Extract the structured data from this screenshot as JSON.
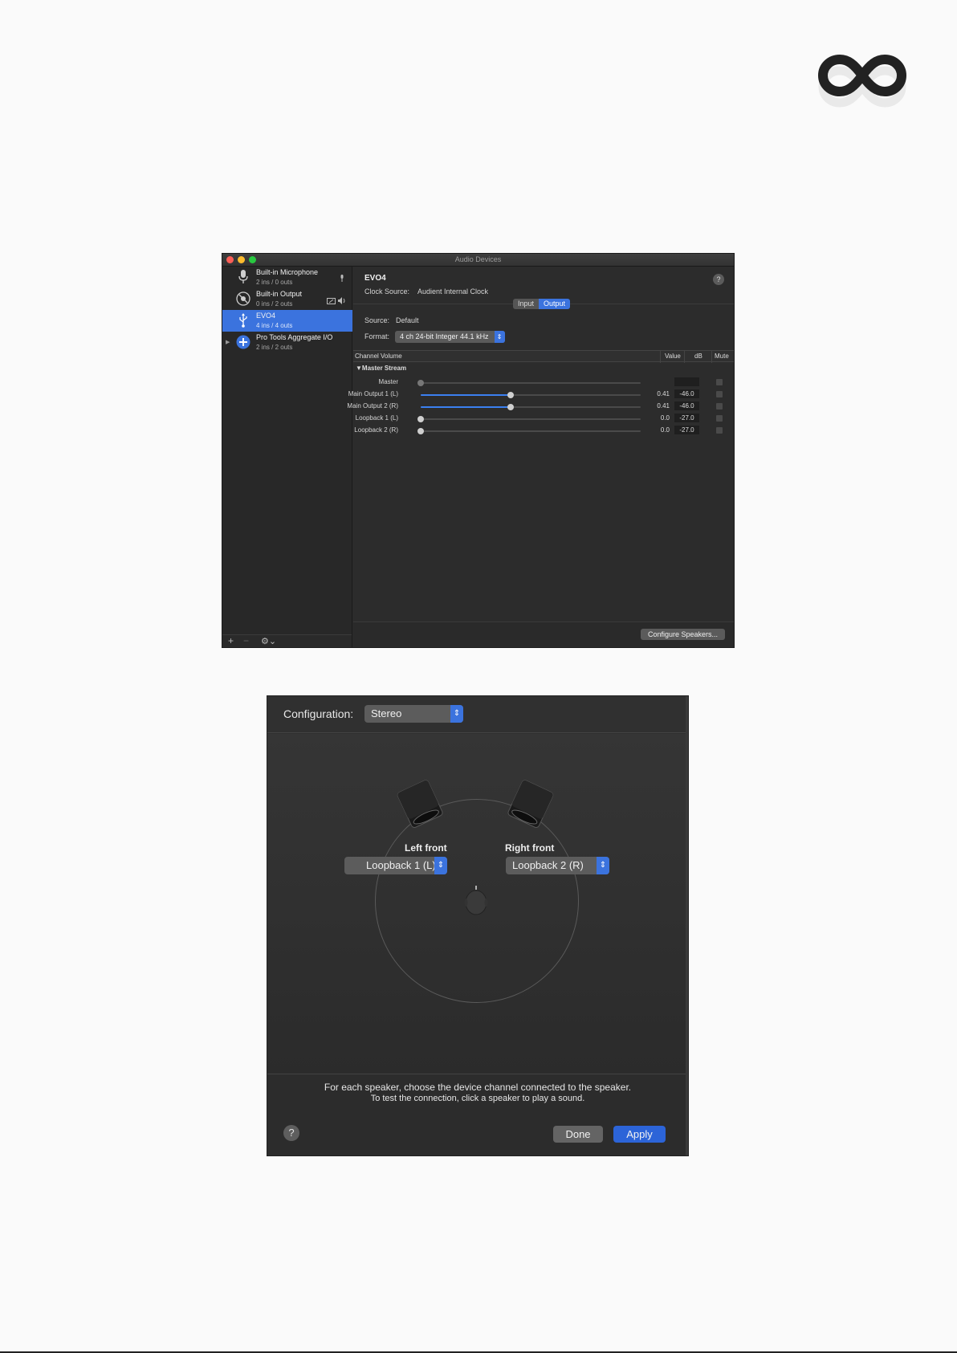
{
  "audio_devices": {
    "window_title": "Audio Devices",
    "devices": [
      {
        "name": "Built-in Microphone",
        "io": "2 ins / 0 outs",
        "icon": "microphone-icon"
      },
      {
        "name": "Built-in Output",
        "io": "0 ins / 2 outs",
        "icon": "speaker-icon"
      },
      {
        "name": "EVO4",
        "io": "4 ins / 4 outs",
        "icon": "usb-icon",
        "selected": true
      },
      {
        "name": "Pro Tools Aggregate I/O",
        "io": "2 ins / 2 outs",
        "icon": "aggregate-plus-icon"
      }
    ],
    "sidebar_footer": {
      "add": "+",
      "remove": "−",
      "gear": "⚙⌄"
    },
    "detail": {
      "device_name": "EVO4",
      "help": "?",
      "clock_source_label": "Clock Source:",
      "clock_source_value": "Audient Internal Clock",
      "tabs": [
        "Input",
        "Output"
      ],
      "active_tab": "Output",
      "source_label": "Source:",
      "source_value": "Default",
      "format_label": "Format:",
      "format_value": "4 ch 24-bit Integer 44.1 kHz",
      "table_headers": {
        "channel": "Channel Volume",
        "value": "Value",
        "db": "dB",
        "mute": "Mute"
      },
      "group": "▼Master Stream",
      "channels": [
        {
          "label": "Master",
          "level": 0,
          "value": "",
          "db": "",
          "active": false
        },
        {
          "label": "Main Output 1 (L)",
          "level": 0.41,
          "value": "0.41",
          "db": "-46.0",
          "active": true
        },
        {
          "label": "Main Output 2 (R)",
          "level": 0.41,
          "value": "0.41",
          "db": "-46.0",
          "active": true
        },
        {
          "label": "Loopback 1 (L)",
          "level": 0,
          "value": "0.0",
          "db": "-27.0",
          "active": true
        },
        {
          "label": "Loopback 2 (R)",
          "level": 0,
          "value": "0.0",
          "db": "-27.0",
          "active": true
        }
      ],
      "configure_button": "Configure Speakers..."
    }
  },
  "speakers_panel": {
    "configuration_label": "Configuration:",
    "configuration_value": "Stereo",
    "left_label": "Left front",
    "left_channel": "Loopback 1 (L)",
    "right_label": "Right front",
    "right_channel": "Loopback 2 (R)",
    "instruction_1": "For each speaker, choose the device channel connected to the speaker.",
    "instruction_2": "To test the connection, click a speaker to play a sound.",
    "help": "?",
    "done_button": "Done",
    "apply_button": "Apply"
  },
  "colors": {
    "accent": "#3b73de",
    "window_bg": "#2b2b2b",
    "page_bg": "#fafafa"
  }
}
